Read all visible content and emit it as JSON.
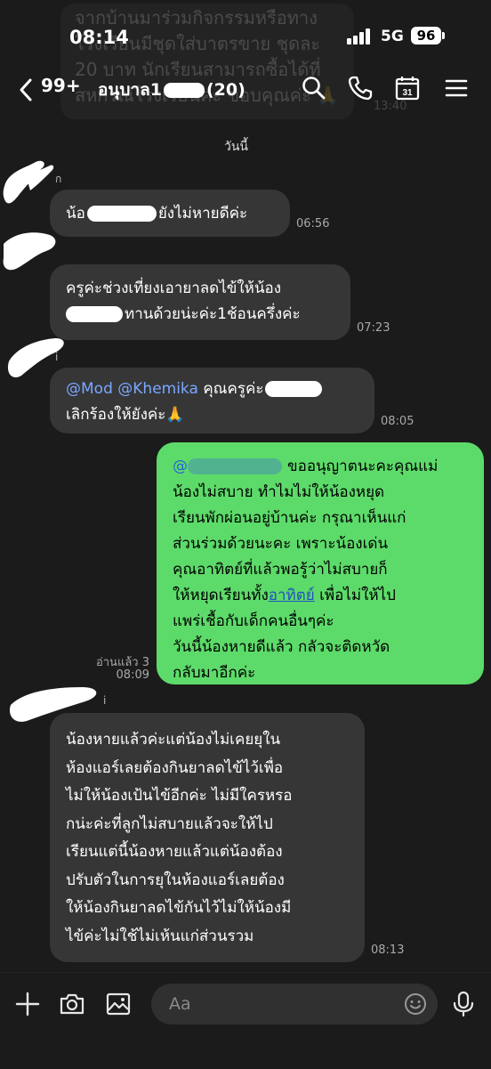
{
  "background_bubble_text": [
    "จากบ้านมาร่วมกิจกรรมหรือทาง",
    "โรงเรียนมีชุดใส่บาตรขาย ชุดละ",
    "20 บาท นักเรียนสามารถซื้อได้ที่",
    "สหกรณ์โรงเรียนค่ะ ขอบคุณค่ะ 🙏"
  ],
  "background_bubble_time": "13:40",
  "status": {
    "time": "08:14",
    "network": "5G",
    "battery": "96"
  },
  "header": {
    "unread_count": "99+",
    "title_prefix": "อนุบาล1",
    "member_count": "(20)"
  },
  "date_divider": "วันนี้",
  "messages": [
    {
      "sender": "ก",
      "lines": [
        "น้อ",
        "ยังไม่หายดีค่ะ"
      ],
      "time": "06:56"
    },
    {
      "lines": [
        "ครูค่ะช่วงเที่ยงเอายาลดไข้ให้น้อง",
        "ทานด้วยน่ะค่ะ1ช้อนครึ่งค่ะ"
      ],
      "time": "07:23"
    },
    {
      "sender": "i",
      "mention1": "@Mod",
      "mention2": "@Khemika",
      "line1_rest": "คุณครูค่ะ",
      "line2": "เลิกร้องให้ยังค่ะ🙏",
      "time": "08:05"
    },
    {
      "outgoing": true,
      "mention": "@",
      "line1_rest": "ขออนุญาตนะคะคุณแม่",
      "lines": [
        "น้องไม่สบาย ทำไมไม่ให้น้องหยุด",
        "เรียนพักผ่อนอยู่บ้านค่ะ กรุณาเห็นแก่",
        "ส่วนร่วมด้วยนะคะ เพราะน้องเด่น",
        "คุณอาทิตย์ที่แล้วพอรู้ว่าไม่สบายก็"
      ],
      "line6_pre": "ให้หยุดเรียนทั้ง",
      "link": "อาทิตย์",
      "line6_post": " เพื่อไม่ให้ไป",
      "lines2": [
        "แพร่เชื้อกับเด็กคนอื่นๆค่ะ",
        "วันนี้น้องหายดีแล้ว กลัวจะติดหวัด",
        "กลับมาอีกค่ะ"
      ],
      "read": "อ่านแล้ว 3",
      "time": "08:09"
    },
    {
      "sender": "i",
      "lines": [
        "น้องหายแล้วค่ะแต่น้องไม่เคยยุใน",
        "ห้องแอร์เลยต้องกินยาลดไข้ไว้เพื่อ",
        "ไม่ให้น้องเป้นไข้อีกค่ะ ไม่มีใครหรอ",
        "กน่ะค่ะที่ลูกไม่สบายแล้วจะให้ไป",
        "เรียนแต่นี้น้องหายแล้วแต่น้องต้อง",
        "ปรับตัวในการยุในห้องแอร์เลยต้อง",
        "ให้น้องกินยาลดไข้กันไว้ไม่ให้น้องมี",
        "ไข้ค่ะไม่ใช้ไม่เห้นแก่ส่วนรวม"
      ],
      "time": "08:13"
    }
  ],
  "composer": {
    "placeholder": "Aa"
  },
  "colors": {
    "outgoing_bubble": "#5ddb6a",
    "incoming_bubble": "#363636",
    "background": "#1b1b1b"
  },
  "icons": [
    "back-chevron-icon",
    "search-icon",
    "phone-icon",
    "calendar-icon",
    "menu-icon",
    "plus-icon",
    "camera-icon",
    "image-icon",
    "emoji-icon",
    "microphone-icon"
  ],
  "calendar_icon_day": "31"
}
